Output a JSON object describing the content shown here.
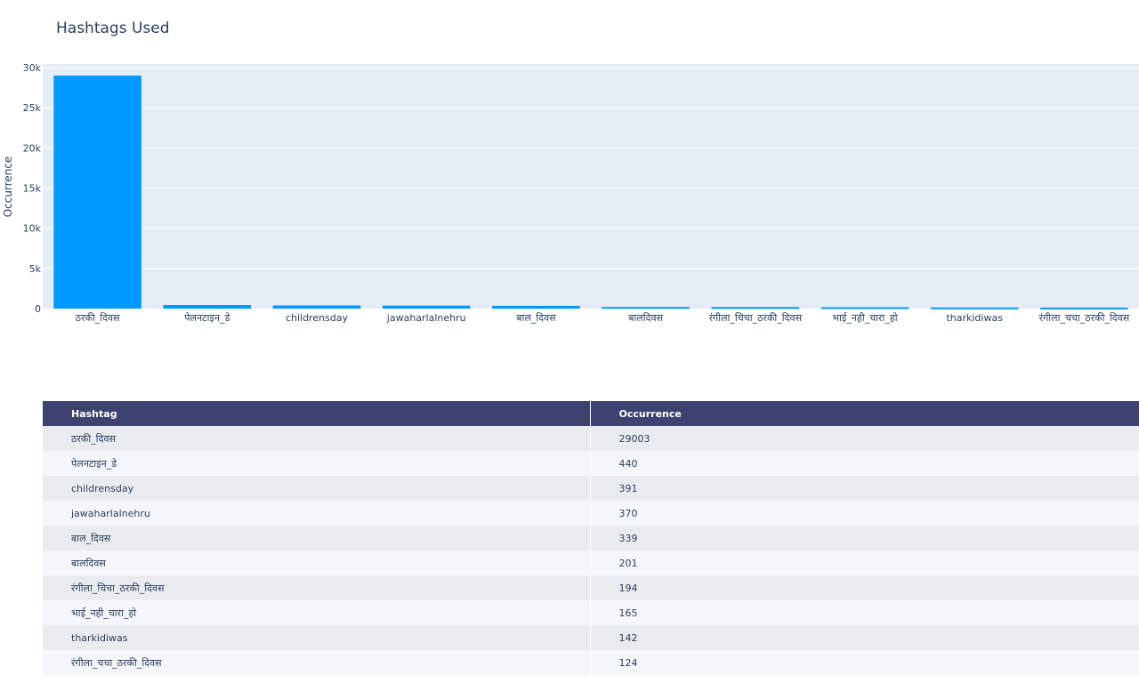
{
  "chart_data": {
    "type": "bar",
    "title": "Hashtags Used",
    "xlabel": "",
    "ylabel": "Occurrence",
    "categories": [
      "ठरकी_दिवस",
      "पेलनटाइन_डे",
      "childrensday",
      "jawaharlalnehru",
      "बाल_दिवस",
      "बालदिवस",
      "रंगीला_चिचा_ठरकी_दिवस",
      "भाई_नही_चारा_हो",
      "tharkidiwas",
      "रंगीला_चचा_ठरकी_दिवस"
    ],
    "values": [
      29003,
      440,
      391,
      370,
      339,
      201,
      194,
      165,
      142,
      124
    ],
    "ylim": [
      0,
      30000
    ],
    "yticks": [
      0,
      5000,
      10000,
      15000,
      20000,
      25000,
      30000
    ],
    "ytick_labels": [
      "0",
      "5k",
      "10k",
      "15k",
      "20k",
      "25k",
      "30k"
    ],
    "grid": true,
    "colors": {
      "bar": "#0099ff",
      "plot_bg": "#e5ecf6",
      "grid": "#ffffff"
    }
  },
  "table": {
    "headers": [
      "Hashtag",
      "Occurrence"
    ],
    "rows": [
      [
        "ठरकी_दिवस",
        "29003"
      ],
      [
        "पेलनटाइन_डे",
        "440"
      ],
      [
        "childrensday",
        "391"
      ],
      [
        "jawaharlalnehru",
        "370"
      ],
      [
        "बाल_दिवस",
        "339"
      ],
      [
        "बालदिवस",
        "201"
      ],
      [
        "रंगीला_चिचा_ठरकी_दिवस",
        "194"
      ],
      [
        "भाई_नही_चारा_हो",
        "165"
      ],
      [
        "tharkidiwas",
        "142"
      ],
      [
        "रंगीला_चचा_ठरकी_दिवस",
        "124"
      ]
    ]
  }
}
